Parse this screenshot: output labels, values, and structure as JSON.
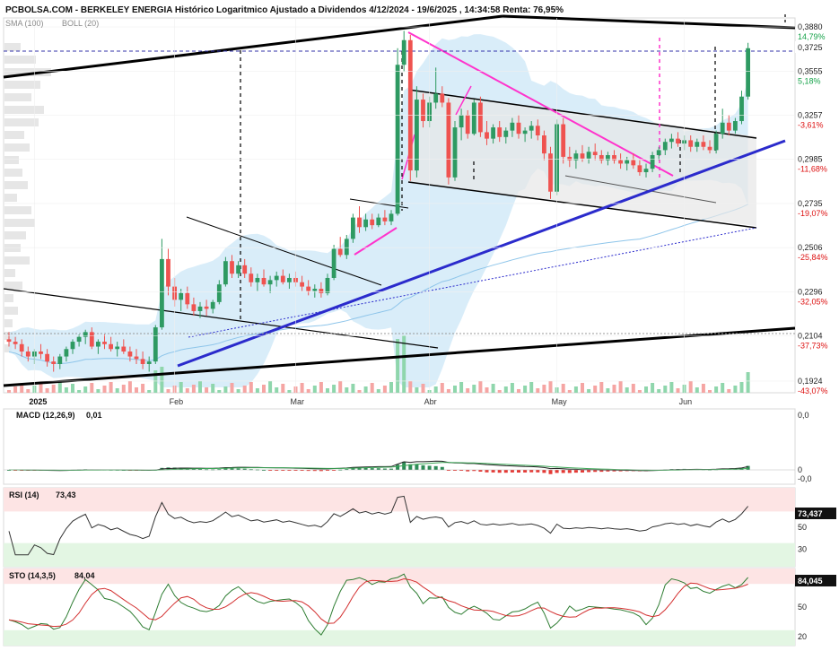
{
  "chart_data": {
    "type": "candlestick",
    "title": "PCBOLSA.COM - BERKELEY ENERGIA Histórico Logaritmico Ajustado a Dividendos 4/12/2024 - 19/6/2025 , 14:34:58 Renta: 76,95%",
    "indicators_label": {
      "sma": "SMA (100)",
      "boll": "BOLL (20)"
    },
    "price_axis": {
      "scale": "log",
      "ylim": [
        0.188,
        0.395
      ],
      "ticks": [
        {
          "value": 0.388,
          "label": "0,3880",
          "pct": "14,79%",
          "up": true
        },
        {
          "value": 0.3555,
          "label": "0,3555",
          "pct": "5,18%",
          "up": true
        },
        {
          "value": 0.3257,
          "label": "0,3257",
          "pct": "-3,61%",
          "up": false
        },
        {
          "value": 0.2985,
          "label": "0,2985",
          "pct": "-11,68%",
          "up": false
        },
        {
          "value": 0.2735,
          "label": "0,2735",
          "pct": "-19,07%",
          "up": false
        },
        {
          "value": 0.2506,
          "label": "0,2506",
          "pct": "-25,84%",
          "up": false
        },
        {
          "value": 0.2296,
          "label": "0,2296",
          "pct": "-32,05%",
          "up": false
        },
        {
          "value": 0.2104,
          "label": "0,2104",
          "pct": "-37,73%",
          "up": false
        },
        {
          "value": 0.1924,
          "label": "0,1924",
          "pct": "-43,07%",
          "up": false
        }
      ],
      "last_price": {
        "value": 0.3725,
        "label": "0,3725"
      }
    },
    "x_axis": {
      "labels": [
        {
          "label": "2025",
          "bar": 4,
          "bold": true
        },
        {
          "label": "Feb",
          "bar": 26,
          "bold": false
        },
        {
          "label": "Mar",
          "bar": 45,
          "bold": false
        },
        {
          "label": "Abr",
          "bar": 66,
          "bold": false
        },
        {
          "label": "May",
          "bar": 86,
          "bold": false
        },
        {
          "label": "Jun",
          "bar": 106,
          "bold": false
        }
      ]
    },
    "bars": [
      {
        "o": 0.209,
        "h": 0.212,
        "l": 0.206,
        "c": 0.208
      },
      {
        "o": 0.208,
        "h": 0.21,
        "l": 0.205,
        "c": 0.207
      },
      {
        "o": 0.207,
        "h": 0.209,
        "l": 0.202,
        "c": 0.204
      },
      {
        "o": 0.204,
        "h": 0.206,
        "l": 0.2,
        "c": 0.202
      },
      {
        "o": 0.202,
        "h": 0.205,
        "l": 0.199,
        "c": 0.204
      },
      {
        "o": 0.204,
        "h": 0.207,
        "l": 0.201,
        "c": 0.203
      },
      {
        "o": 0.203,
        "h": 0.205,
        "l": 0.198,
        "c": 0.2
      },
      {
        "o": 0.2,
        "h": 0.202,
        "l": 0.196,
        "c": 0.199
      },
      {
        "o": 0.199,
        "h": 0.203,
        "l": 0.197,
        "c": 0.202
      },
      {
        "o": 0.202,
        "h": 0.206,
        "l": 0.2,
        "c": 0.205
      },
      {
        "o": 0.205,
        "h": 0.209,
        "l": 0.203,
        "c": 0.208
      },
      {
        "o": 0.208,
        "h": 0.211,
        "l": 0.206,
        "c": 0.21
      },
      {
        "o": 0.21,
        "h": 0.213,
        "l": 0.207,
        "c": 0.212
      },
      {
        "o": 0.212,
        "h": 0.214,
        "l": 0.205,
        "c": 0.206
      },
      {
        "o": 0.206,
        "h": 0.209,
        "l": 0.203,
        "c": 0.208
      },
      {
        "o": 0.208,
        "h": 0.211,
        "l": 0.205,
        "c": 0.207
      },
      {
        "o": 0.207,
        "h": 0.21,
        "l": 0.204,
        "c": 0.205
      },
      {
        "o": 0.205,
        "h": 0.208,
        "l": 0.202,
        "c": 0.206
      },
      {
        "o": 0.206,
        "h": 0.209,
        "l": 0.203,
        "c": 0.204
      },
      {
        "o": 0.204,
        "h": 0.206,
        "l": 0.2,
        "c": 0.202
      },
      {
        "o": 0.202,
        "h": 0.205,
        "l": 0.199,
        "c": 0.201
      },
      {
        "o": 0.201,
        "h": 0.204,
        "l": 0.197,
        "c": 0.199
      },
      {
        "o": 0.199,
        "h": 0.202,
        "l": 0.196,
        "c": 0.2
      },
      {
        "o": 0.2,
        "h": 0.215,
        "l": 0.199,
        "c": 0.214
      },
      {
        "o": 0.214,
        "h": 0.255,
        "l": 0.213,
        "c": 0.245
      },
      {
        "o": 0.245,
        "h": 0.25,
        "l": 0.228,
        "c": 0.232
      },
      {
        "o": 0.232,
        "h": 0.236,
        "l": 0.223,
        "c": 0.226
      },
      {
        "o": 0.226,
        "h": 0.231,
        "l": 0.221,
        "c": 0.229
      },
      {
        "o": 0.229,
        "h": 0.232,
        "l": 0.222,
        "c": 0.224
      },
      {
        "o": 0.224,
        "h": 0.227,
        "l": 0.219,
        "c": 0.221
      },
      {
        "o": 0.221,
        "h": 0.225,
        "l": 0.218,
        "c": 0.223
      },
      {
        "o": 0.223,
        "h": 0.226,
        "l": 0.219,
        "c": 0.222
      },
      {
        "o": 0.222,
        "h": 0.226,
        "l": 0.22,
        "c": 0.225
      },
      {
        "o": 0.225,
        "h": 0.235,
        "l": 0.224,
        "c": 0.233
      },
      {
        "o": 0.233,
        "h": 0.246,
        "l": 0.232,
        "c": 0.244
      },
      {
        "o": 0.244,
        "h": 0.247,
        "l": 0.236,
        "c": 0.238
      },
      {
        "o": 0.238,
        "h": 0.244,
        "l": 0.236,
        "c": 0.242
      },
      {
        "o": 0.242,
        "h": 0.245,
        "l": 0.236,
        "c": 0.238
      },
      {
        "o": 0.238,
        "h": 0.241,
        "l": 0.232,
        "c": 0.234
      },
      {
        "o": 0.234,
        "h": 0.238,
        "l": 0.23,
        "c": 0.236
      },
      {
        "o": 0.236,
        "h": 0.24,
        "l": 0.232,
        "c": 0.233
      },
      {
        "o": 0.233,
        "h": 0.237,
        "l": 0.229,
        "c": 0.235
      },
      {
        "o": 0.235,
        "h": 0.239,
        "l": 0.232,
        "c": 0.237
      },
      {
        "o": 0.237,
        "h": 0.24,
        "l": 0.233,
        "c": 0.234
      },
      {
        "o": 0.234,
        "h": 0.238,
        "l": 0.231,
        "c": 0.236
      },
      {
        "o": 0.236,
        "h": 0.239,
        "l": 0.232,
        "c": 0.234
      },
      {
        "o": 0.234,
        "h": 0.237,
        "l": 0.23,
        "c": 0.232
      },
      {
        "o": 0.232,
        "h": 0.235,
        "l": 0.228,
        "c": 0.23
      },
      {
        "o": 0.23,
        "h": 0.233,
        "l": 0.227,
        "c": 0.231
      },
      {
        "o": 0.231,
        "h": 0.234,
        "l": 0.227,
        "c": 0.229
      },
      {
        "o": 0.229,
        "h": 0.238,
        "l": 0.228,
        "c": 0.236
      },
      {
        "o": 0.236,
        "h": 0.252,
        "l": 0.235,
        "c": 0.25
      },
      {
        "o": 0.25,
        "h": 0.256,
        "l": 0.246,
        "c": 0.247
      },
      {
        "o": 0.247,
        "h": 0.257,
        "l": 0.245,
        "c": 0.255
      },
      {
        "o": 0.255,
        "h": 0.268,
        "l": 0.253,
        "c": 0.266
      },
      {
        "o": 0.266,
        "h": 0.272,
        "l": 0.258,
        "c": 0.261
      },
      {
        "o": 0.261,
        "h": 0.268,
        "l": 0.259,
        "c": 0.265
      },
      {
        "o": 0.265,
        "h": 0.268,
        "l": 0.26,
        "c": 0.262
      },
      {
        "o": 0.262,
        "h": 0.268,
        "l": 0.261,
        "c": 0.266
      },
      {
        "o": 0.266,
        "h": 0.27,
        "l": 0.262,
        "c": 0.264
      },
      {
        "o": 0.264,
        "h": 0.27,
        "l": 0.262,
        "c": 0.268
      },
      {
        "o": 0.268,
        "h": 0.372,
        "l": 0.267,
        "c": 0.36
      },
      {
        "o": 0.36,
        "h": 0.385,
        "l": 0.355,
        "c": 0.378
      },
      {
        "o": 0.378,
        "h": 0.382,
        "l": 0.286,
        "c": 0.292
      },
      {
        "o": 0.292,
        "h": 0.345,
        "l": 0.288,
        "c": 0.336
      },
      {
        "o": 0.336,
        "h": 0.34,
        "l": 0.318,
        "c": 0.322
      },
      {
        "o": 0.322,
        "h": 0.338,
        "l": 0.318,
        "c": 0.334
      },
      {
        "o": 0.334,
        "h": 0.358,
        "l": 0.33,
        "c": 0.34
      },
      {
        "o": 0.34,
        "h": 0.345,
        "l": 0.331,
        "c": 0.334
      },
      {
        "o": 0.334,
        "h": 0.337,
        "l": 0.284,
        "c": 0.288
      },
      {
        "o": 0.288,
        "h": 0.322,
        "l": 0.286,
        "c": 0.318
      },
      {
        "o": 0.318,
        "h": 0.33,
        "l": 0.31,
        "c": 0.326
      },
      {
        "o": 0.326,
        "h": 0.329,
        "l": 0.311,
        "c": 0.314
      },
      {
        "o": 0.314,
        "h": 0.336,
        "l": 0.313,
        "c": 0.334
      },
      {
        "o": 0.334,
        "h": 0.338,
        "l": 0.312,
        "c": 0.315
      },
      {
        "o": 0.315,
        "h": 0.322,
        "l": 0.307,
        "c": 0.311
      },
      {
        "o": 0.311,
        "h": 0.32,
        "l": 0.308,
        "c": 0.318
      },
      {
        "o": 0.318,
        "h": 0.322,
        "l": 0.309,
        "c": 0.312
      },
      {
        "o": 0.312,
        "h": 0.318,
        "l": 0.308,
        "c": 0.316
      },
      {
        "o": 0.316,
        "h": 0.324,
        "l": 0.312,
        "c": 0.321
      },
      {
        "o": 0.321,
        "h": 0.326,
        "l": 0.311,
        "c": 0.314
      },
      {
        "o": 0.314,
        "h": 0.318,
        "l": 0.309,
        "c": 0.316
      },
      {
        "o": 0.316,
        "h": 0.322,
        "l": 0.311,
        "c": 0.319
      },
      {
        "o": 0.319,
        "h": 0.323,
        "l": 0.31,
        "c": 0.313
      },
      {
        "o": 0.313,
        "h": 0.316,
        "l": 0.298,
        "c": 0.302
      },
      {
        "o": 0.302,
        "h": 0.306,
        "l": 0.276,
        "c": 0.28
      },
      {
        "o": 0.28,
        "h": 0.323,
        "l": 0.278,
        "c": 0.32
      },
      {
        "o": 0.32,
        "h": 0.324,
        "l": 0.296,
        "c": 0.3
      },
      {
        "o": 0.3,
        "h": 0.306,
        "l": 0.294,
        "c": 0.298
      },
      {
        "o": 0.298,
        "h": 0.304,
        "l": 0.293,
        "c": 0.302
      },
      {
        "o": 0.302,
        "h": 0.307,
        "l": 0.297,
        "c": 0.299
      },
      {
        "o": 0.299,
        "h": 0.306,
        "l": 0.296,
        "c": 0.303
      },
      {
        "o": 0.303,
        "h": 0.308,
        "l": 0.298,
        "c": 0.301
      },
      {
        "o": 0.301,
        "h": 0.304,
        "l": 0.296,
        "c": 0.298
      },
      {
        "o": 0.298,
        "h": 0.303,
        "l": 0.295,
        "c": 0.301
      },
      {
        "o": 0.301,
        "h": 0.304,
        "l": 0.296,
        "c": 0.298
      },
      {
        "o": 0.298,
        "h": 0.302,
        "l": 0.293,
        "c": 0.296
      },
      {
        "o": 0.296,
        "h": 0.3,
        "l": 0.292,
        "c": 0.298
      },
      {
        "o": 0.298,
        "h": 0.302,
        "l": 0.293,
        "c": 0.295
      },
      {
        "o": 0.295,
        "h": 0.298,
        "l": 0.289,
        "c": 0.291
      },
      {
        "o": 0.291,
        "h": 0.296,
        "l": 0.288,
        "c": 0.293
      },
      {
        "o": 0.293,
        "h": 0.303,
        "l": 0.291,
        "c": 0.301
      },
      {
        "o": 0.301,
        "h": 0.306,
        "l": 0.298,
        "c": 0.304
      },
      {
        "o": 0.304,
        "h": 0.311,
        "l": 0.301,
        "c": 0.309
      },
      {
        "o": 0.309,
        "h": 0.314,
        "l": 0.305,
        "c": 0.311
      },
      {
        "o": 0.311,
        "h": 0.315,
        "l": 0.306,
        "c": 0.308
      },
      {
        "o": 0.308,
        "h": 0.313,
        "l": 0.304,
        "c": 0.31
      },
      {
        "o": 0.31,
        "h": 0.313,
        "l": 0.303,
        "c": 0.306
      },
      {
        "o": 0.306,
        "h": 0.311,
        "l": 0.303,
        "c": 0.309
      },
      {
        "o": 0.309,
        "h": 0.313,
        "l": 0.304,
        "c": 0.306
      },
      {
        "o": 0.306,
        "h": 0.31,
        "l": 0.302,
        "c": 0.304
      },
      {
        "o": 0.304,
        "h": 0.316,
        "l": 0.302,
        "c": 0.314
      },
      {
        "o": 0.314,
        "h": 0.33,
        "l": 0.311,
        "c": 0.321
      },
      {
        "o": 0.321,
        "h": 0.326,
        "l": 0.313,
        "c": 0.316
      },
      {
        "o": 0.316,
        "h": 0.324,
        "l": 0.314,
        "c": 0.322
      },
      {
        "o": 0.322,
        "h": 0.342,
        "l": 0.32,
        "c": 0.338
      },
      {
        "o": 0.338,
        "h": 0.376,
        "l": 0.336,
        "c": 0.372
      }
    ],
    "macd": {
      "label": "MACD (12,26,9)",
      "value": "0,01",
      "ticks": [
        "0,0",
        "0",
        "-0,0"
      ]
    },
    "rsi": {
      "label": "RSI (14)",
      "value": "73,43",
      "badge": "73,437",
      "ticks": [
        "50",
        "30"
      ]
    },
    "sto": {
      "label": "STO (14,3,5)",
      "value": "84,04",
      "badge": "84,045",
      "ticks": [
        "50",
        "20"
      ]
    },
    "colors": {
      "up": "#2e9a62",
      "down": "#ef5350",
      "macd_up": "#2e8b57",
      "macd_down": "#e53935",
      "band": "#cfe8f7",
      "trend": "#000000",
      "support": "#2b2bcc",
      "magenta": "#ff33cc"
    }
  }
}
